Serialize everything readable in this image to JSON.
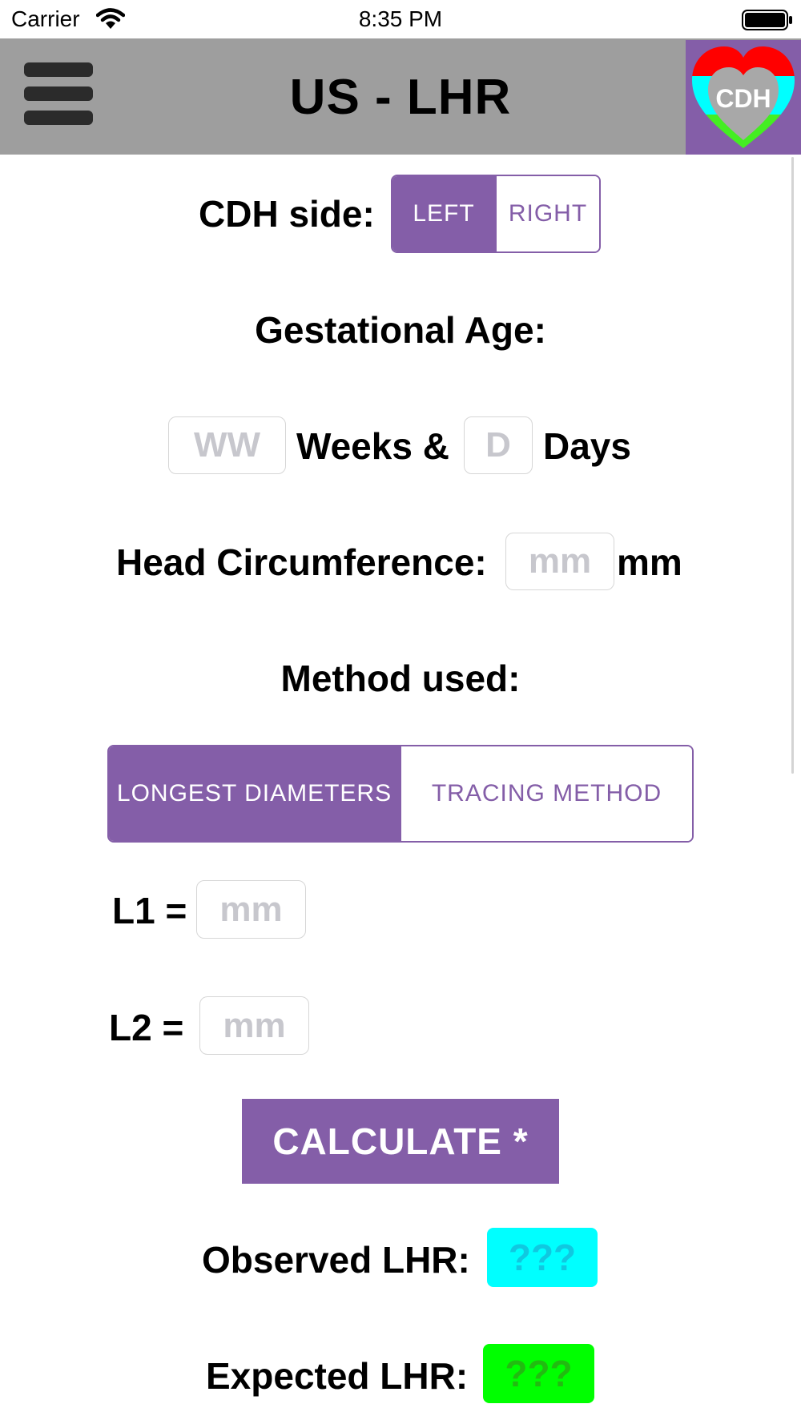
{
  "status_bar": {
    "carrier": "Carrier",
    "time": "8:35 PM"
  },
  "nav": {
    "title": "US - LHR",
    "menu_icon": "hamburger-menu-icon",
    "logo_text": "CDH",
    "logo_colors": {
      "background": "#845ea8",
      "top": "#ff0000",
      "middle": "#00ffff",
      "bottom": "#44ee22",
      "heart": "#a8a8a8"
    }
  },
  "cdh_side": {
    "label": "CDH side:",
    "options": [
      "LEFT",
      "RIGHT"
    ],
    "selected": "LEFT"
  },
  "gestational_age": {
    "label": "Gestational Age:",
    "weeks_placeholder": "WW",
    "weeks_label": "Weeks &",
    "days_placeholder": "D",
    "days_label": "Days"
  },
  "head_circumference": {
    "label": "Head Circumference:",
    "placeholder": "mm",
    "unit": "mm"
  },
  "method": {
    "label": "Method used:",
    "options": [
      "LONGEST DIAMETERS",
      "TRACING METHOD"
    ],
    "selected": "LONGEST DIAMETERS"
  },
  "l1": {
    "label": "L1 =",
    "placeholder": "mm"
  },
  "l2": {
    "label": "L2 =",
    "placeholder": "mm"
  },
  "calculate_button": "CALCULATE *",
  "observed_lhr": {
    "label": "Observed LHR:",
    "value": "???",
    "color": "#00ffff"
  },
  "expected_lhr": {
    "label": "Expected LHR:",
    "value": "???",
    "color": "#00ff00"
  },
  "colors": {
    "accent": "#845ea8",
    "nav_background": "#9e9e9e"
  }
}
